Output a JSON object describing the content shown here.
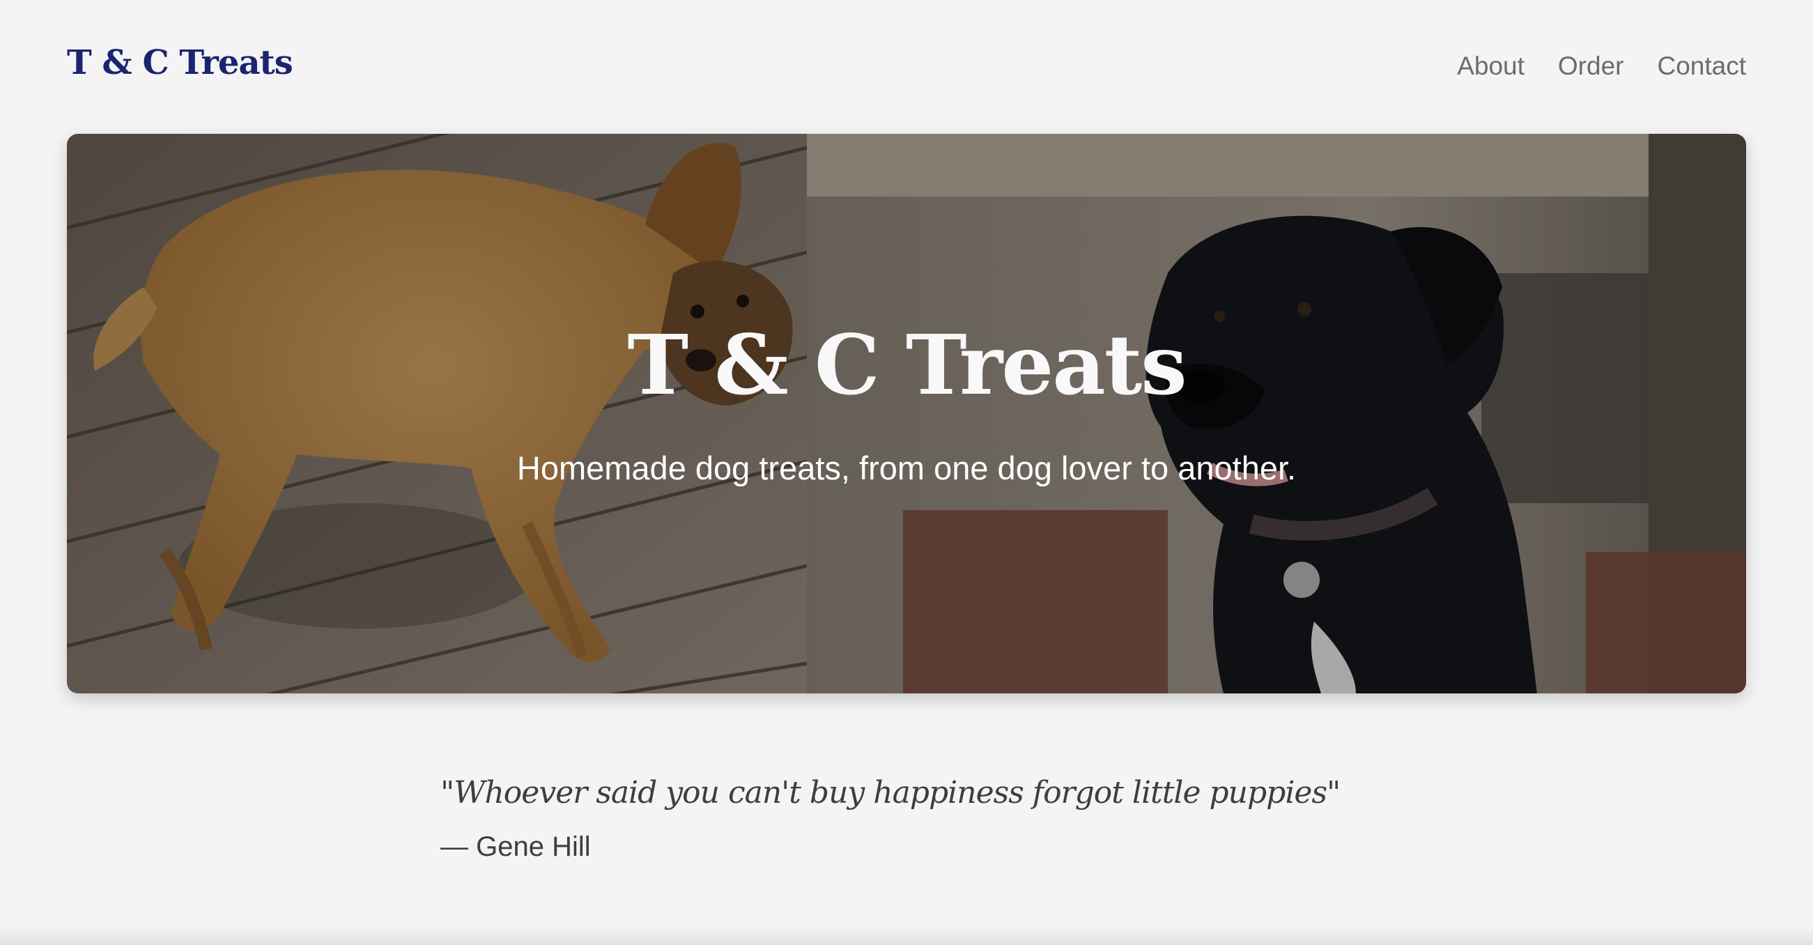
{
  "header": {
    "logo": "T & C Treats",
    "nav": [
      "About",
      "Order",
      "Contact"
    ]
  },
  "hero": {
    "title": "T & C Treats",
    "subtitle": "Homemade dog treats, from one dog lover to another.",
    "images": [
      "tan-dog-lying-on-deck-photo",
      "black-dog-portrait-photo"
    ]
  },
  "quote": {
    "text": "\"Whoever said you can't buy happiness forgot little puppies\"",
    "author": "— Gene Hill"
  },
  "colors": {
    "background": "#f4f4f4",
    "brand": "#1b2470",
    "nav_text": "#6b6c70",
    "body_text": "#3d3d42"
  }
}
